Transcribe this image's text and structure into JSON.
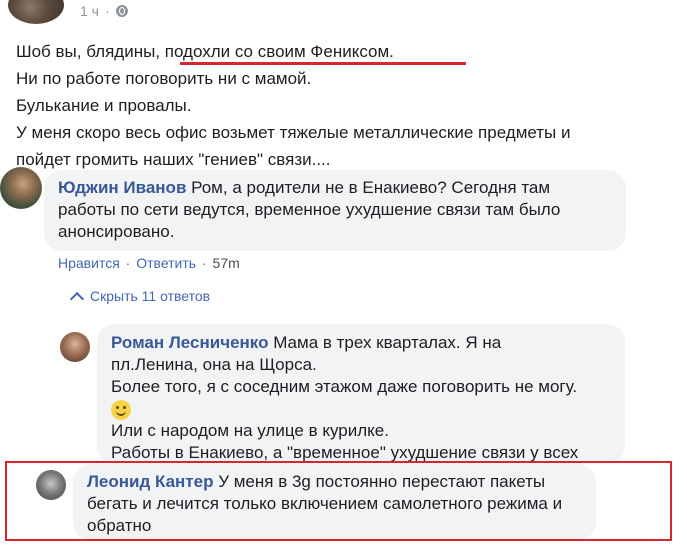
{
  "meta": {
    "time": "1 ч"
  },
  "post": {
    "lines": [
      "Шоб вы, блядины, подохли со своим Фениксом.",
      "Ни по работе поговорить ни с мамой.",
      "Булькание и провалы.",
      "У меня скоро весь офис возьмет тяжелые металлические предметы и",
      "пойдет громить наших \"гениев\" связи...."
    ]
  },
  "comments": [
    {
      "author": "Юджин Иванов",
      "lines": [
        "Ром, а родители не в Енакиево? Сегодня там",
        "работы по сети ведутся, временное ухудшение связи там было",
        "анонсировано."
      ],
      "actions": {
        "like": "Нравится",
        "reply": "Ответить",
        "time": "57m"
      }
    }
  ],
  "hide_replies": "Скрыть 11 ответов",
  "replies": [
    {
      "author": "Роман Лесниченко",
      "lines": [
        "Мама в трех кварталах. Я на",
        "пл.Ленина, она на Щорса.",
        "Более того, я с соседним этажом даже поговорить не могу.",
        "Или с народом на улице в курилке.",
        "Работы в Енакиево, а \"временное\" ухудшение связи у всех"
      ]
    },
    {
      "author": "Леонид Кантер",
      "lines": [
        "У меня в 3g постоянно перестают пакеты",
        "бегать и лечится только включением самолетного режима и",
        "обратно"
      ]
    }
  ],
  "icons": {
    "globe": "globe-icon",
    "chevron": "chevron-up-icon",
    "emoji": "smile-emoji-icon"
  },
  "colors": {
    "link": "#385898",
    "bubble": "#f2f3f5",
    "highlight": "#d6262e"
  }
}
